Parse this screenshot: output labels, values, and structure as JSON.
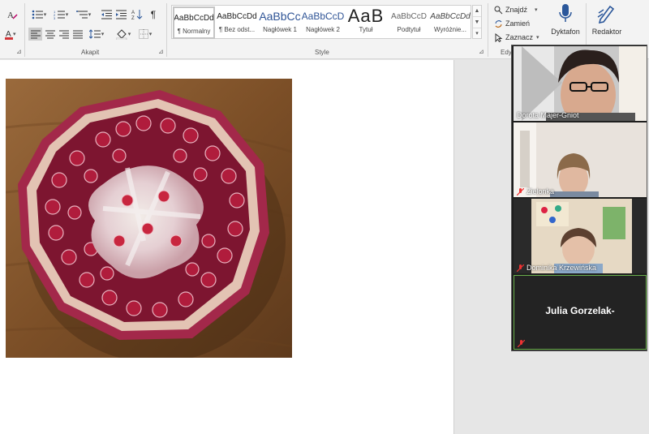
{
  "ribbon": {
    "groups": {
      "paragraph": "Akapit",
      "styles": "Style",
      "editing": "Edy"
    },
    "styles": [
      {
        "preview": "AaBbCcDd",
        "name": "¶ Normalny",
        "selected": true
      },
      {
        "preview": "AaBbCcDd",
        "name": "¶ Bez odst..."
      },
      {
        "preview": "AaBbCc",
        "name": "Nagłówek 1"
      },
      {
        "preview": "AaBbCcD",
        "name": "Nagłówek 2"
      },
      {
        "preview": "AaB",
        "name": "Tytuł"
      },
      {
        "preview": "AaBbCcD",
        "name": "Podtytuł"
      },
      {
        "preview": "AaBbCcDd",
        "name": "Wyróżnie..."
      }
    ],
    "editing": {
      "find": "Znajdź",
      "replace": "Zamień",
      "select": "Zaznacz"
    },
    "dictate": "Dyktafon",
    "editor": "Redaktor"
  },
  "video": {
    "participants": [
      {
        "name": "Dorota Majer-Gniot",
        "muted": false
      },
      {
        "name": "Zielonka",
        "muted": true
      },
      {
        "name": "Dominika Krzewińska",
        "muted": true
      },
      {
        "name": "Julia Gorzelak-",
        "muted": true,
        "video_off": true
      }
    ]
  },
  "colors": {
    "ribbon_bg": "#f3f3f3",
    "accent_blue": "#2b579a",
    "font_color_red": "#d13438",
    "active_speaker_border": "#6ab04c"
  }
}
